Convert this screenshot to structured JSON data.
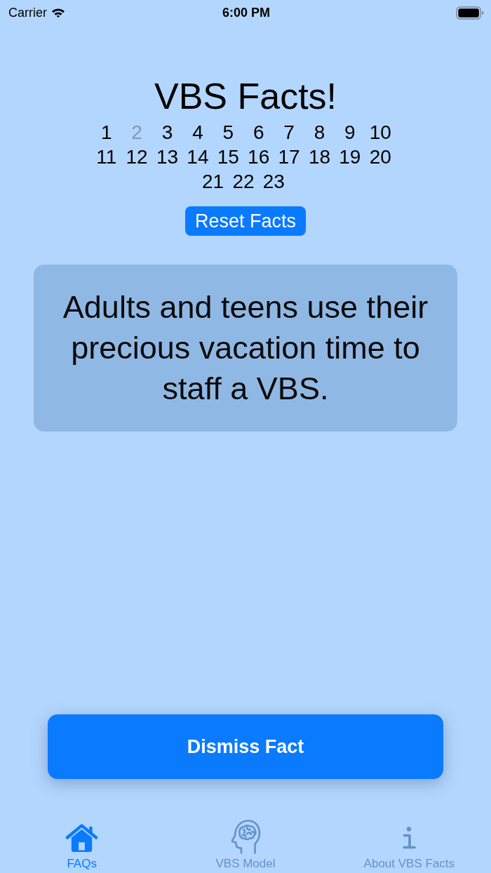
{
  "status_bar": {
    "carrier": "Carrier",
    "time": "6:00 PM"
  },
  "title": "VBS Facts!",
  "fact_numbers": [
    {
      "label": "1",
      "disabled": false
    },
    {
      "label": "2",
      "disabled": true
    },
    {
      "label": "3",
      "disabled": false
    },
    {
      "label": "4",
      "disabled": false
    },
    {
      "label": "5",
      "disabled": false
    },
    {
      "label": "6",
      "disabled": false
    },
    {
      "label": "7",
      "disabled": false
    },
    {
      "label": "8",
      "disabled": false
    },
    {
      "label": "9",
      "disabled": false
    },
    {
      "label": "10",
      "disabled": false
    },
    {
      "label": "11",
      "disabled": false
    },
    {
      "label": "12",
      "disabled": false
    },
    {
      "label": "13",
      "disabled": false
    },
    {
      "label": "14",
      "disabled": false
    },
    {
      "label": "15",
      "disabled": false
    },
    {
      "label": "16",
      "disabled": false
    },
    {
      "label": "17",
      "disabled": false
    },
    {
      "label": "18",
      "disabled": false
    },
    {
      "label": "19",
      "disabled": false
    },
    {
      "label": "20",
      "disabled": false
    },
    {
      "label": "21",
      "disabled": false
    },
    {
      "label": "22",
      "disabled": false
    },
    {
      "label": "23",
      "disabled": false
    }
  ],
  "reset_button": "Reset Facts",
  "fact_card": {
    "text": "Adults and teens use their precious vacation time to staff a VBS."
  },
  "dismiss_button": "Dismiss Fact",
  "tab_bar": [
    {
      "label": "FAQs",
      "selected": true,
      "kind": "home"
    },
    {
      "label": "VBS Model",
      "selected": false,
      "kind": "brain"
    },
    {
      "label": "About VBS Facts",
      "selected": false,
      "kind": "info"
    }
  ]
}
